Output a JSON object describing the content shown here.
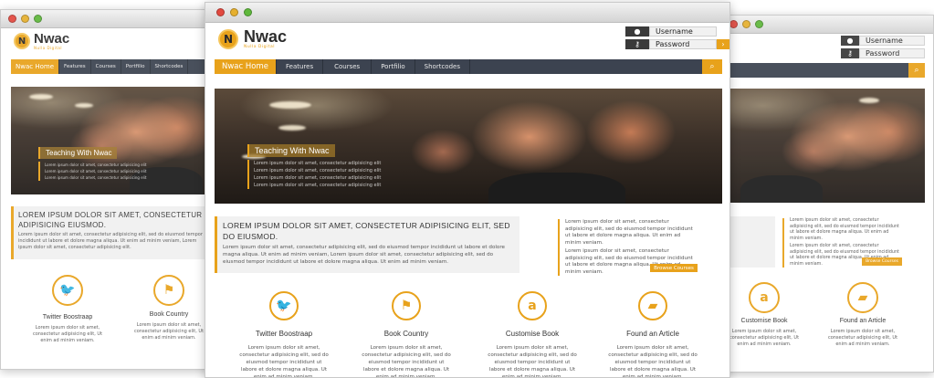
{
  "brand": {
    "name": "Nwac",
    "tagline": "Nulla Digital",
    "badge": "N",
    "accent": "#e8a21b",
    "nav_bg": "#3c4350"
  },
  "login": {
    "username_label": "Username",
    "password_label": "Password",
    "user_icon": "user-icon",
    "key_icon": "key-icon",
    "go_glyph": "›"
  },
  "nav": {
    "items": [
      "Nwac Home",
      "Features",
      "Courses",
      "Portfilio",
      "Shortcodes"
    ],
    "left_items": [
      "Nwac Home",
      "Features",
      "Courses",
      "Portfilio",
      "Shortcodes"
    ],
    "search_icon": "search-icon"
  },
  "hero": {
    "title": "Teaching With Nwac",
    "lines": [
      "Lorem ipsum dolor sit amet, consectetur adipisicing elit",
      "Lorem ipsum dolor sit amet, consectetur adipisicing elit",
      "Lorem ipsum dolor sit amet, consectetur adipisicing elit",
      "Lorem ipsum dolor sit amet, consectetur adipisicing elit"
    ]
  },
  "intro": {
    "heading": "Lorem ipsum dolor sit amet, consectetur adipisicing elit, sed do eiusmod.",
    "left_heading": "Lorem ipsum dolor sit amet, consectetur adipisicing eiusmod.",
    "body": "Lorem ipsum dolor sit amet, consectetur adipisicing elit, sed do eiusmod tempor incididunt ut labore et dolore magna aliqua. Ut enim ad minim veniam, Lorem ipsum dolor sit amet, consectetur adipisicing elit, sed do eiusmod tempor incididunt ut labore et dolore magna aliqua. Ut enim ad minim veniam.",
    "left_body": "Lorem ipsum dolor sit amet, consectetur adipisicing elit, sed do eiusmod tempor incididunt ut labore et dolore magna aliqua. Ut enim ad minim veniam, Lorem ipsum dolor sit amet, consectetur adipisicing elit."
  },
  "bullets": {
    "items": [
      "Lorem ipsum dolor sit amet, consectetur adipisicing elit, sed do eiusmod tempor incididunt ut labore et dolore magna aliqua. Ut enim ad minim veniam.",
      "Lorem ipsum dolor sit amet, consectetur adipisicing elit, sed do eiusmod tempor incididunt ut labore et dolore magna aliqua. Ut enim ad minim veniam."
    ],
    "button": "Browse Courses"
  },
  "features": [
    {
      "title": "Twitter Boostraap",
      "icon": "twitter-bird-icon",
      "glyph": "🐦",
      "text": "Lorem ipsum dolor sit amet, consectetur adipisicing elit, sed do eiusmod tempor incididunt ut labore et dolore magna aliqua. Ut enim ad minim veniam."
    },
    {
      "title": "Book Country",
      "icon": "flag-icon",
      "glyph": "⚑",
      "text": "Lorem ipsum dolor sit amet, consectetur adipisicing elit, sed do eiusmod tempor incididunt ut labore et dolore magna aliqua. Ut enim ad minim veniam."
    },
    {
      "title": "Customise Book",
      "icon": "amazon-icon",
      "glyph": "a",
      "text": "Lorem ipsum dolor sit amet, consectetur adipisicing elit, sed do eiusmod tempor incididunt ut labore et dolore magna aliqua. Ut enim ad minim veniam."
    },
    {
      "title": "Found an Article",
      "icon": "folder-icon",
      "glyph": "▰",
      "text": "Lorem ipsum dolor sit amet, consectetur adipisicing elit, sed do eiusmod tempor incididunt ut labore et dolore magna aliqua. Ut enim ad minim veniam."
    }
  ],
  "left_feature_text": "Lorem ipsum dolor sit amet, consectetur adipisicing elit, Ut enim ad minim veniam."
}
